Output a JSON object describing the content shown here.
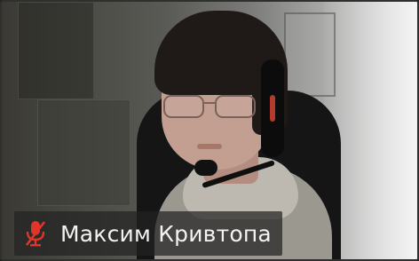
{
  "participant": {
    "name": "Максим Кривтопа",
    "mic_status": "muted"
  },
  "icons": {
    "mic": "microphone-muted-icon"
  },
  "colors": {
    "mute_red": "#e0352b",
    "label_bg": "#222222",
    "label_text": "#f2f2f2"
  }
}
